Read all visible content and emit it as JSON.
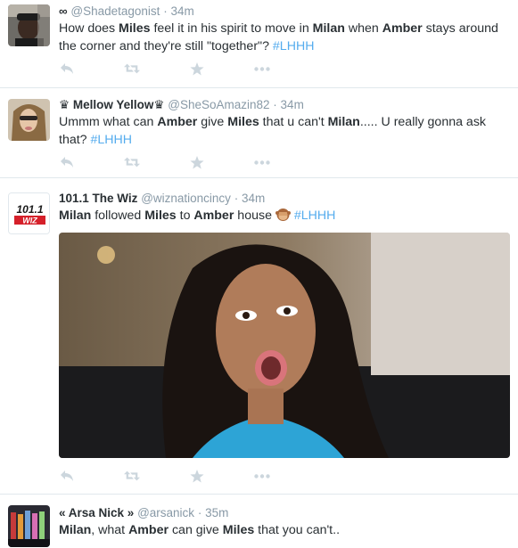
{
  "tweets": [
    {
      "name": "",
      "prefix_icon": "infinity-icon",
      "handle": "@Shadetagonist",
      "time": "34m",
      "text": [
        {
          "t": "How does "
        },
        {
          "t": "Miles",
          "b": true
        },
        {
          "t": " feel it in his spirit to move in "
        },
        {
          "t": "Milan",
          "b": true
        },
        {
          "t": " when "
        },
        {
          "t": "Amber",
          "b": true
        },
        {
          "t": " stays around the corner and they're still \"together\"? "
        },
        {
          "t": "#LHHH",
          "h": true
        }
      ]
    },
    {
      "name": "♛ Mellow Yellow♛",
      "handle": "@SheSoAmazin82",
      "time": "34m",
      "text": [
        {
          "t": "Ummm what can "
        },
        {
          "t": "Amber",
          "b": true
        },
        {
          "t": " give "
        },
        {
          "t": "Miles",
          "b": true
        },
        {
          "t": " that u can't "
        },
        {
          "t": "Milan",
          "b": true
        },
        {
          "t": "..... U really gonna ask that?  "
        },
        {
          "t": "#LHHH",
          "h": true
        }
      ]
    },
    {
      "name": "101.1 The Wiz",
      "handle": "@wiznationcincy",
      "time": "34m",
      "avatar_text_top": "101.1",
      "avatar_text_bottom": "WIZ",
      "emoji_icon": "see-no-evil-monkey-icon",
      "text": [
        {
          "t": "Milan",
          "b": true
        },
        {
          "t": " followed "
        },
        {
          "t": "Miles",
          "b": true
        },
        {
          "t": " to "
        },
        {
          "t": "Amber",
          "b": true
        },
        {
          "t": " house "
        },
        {
          "t": "EMOJI",
          "e": true
        },
        {
          "t": " "
        },
        {
          "t": "#LHHH",
          "h": true
        }
      ]
    },
    {
      "name": "« Arsa Nick »",
      "handle": "@arsanick",
      "time": "35m",
      "text": [
        {
          "t": "Milan",
          "b": true
        },
        {
          "t": ", what "
        },
        {
          "t": "Amber",
          "b": true
        },
        {
          "t": " can give "
        },
        {
          "t": "Miles",
          "b": true
        },
        {
          "t": " that you can't.."
        }
      ]
    }
  ],
  "actions": [
    "reply-icon",
    "retweet-icon",
    "favorite-icon",
    "more-icon"
  ],
  "colors": {
    "text": "#292f33",
    "muted": "#8899a6",
    "icon": "#ccd6dd",
    "hashtag": "#55acee",
    "divider": "#e1e8ed"
  }
}
